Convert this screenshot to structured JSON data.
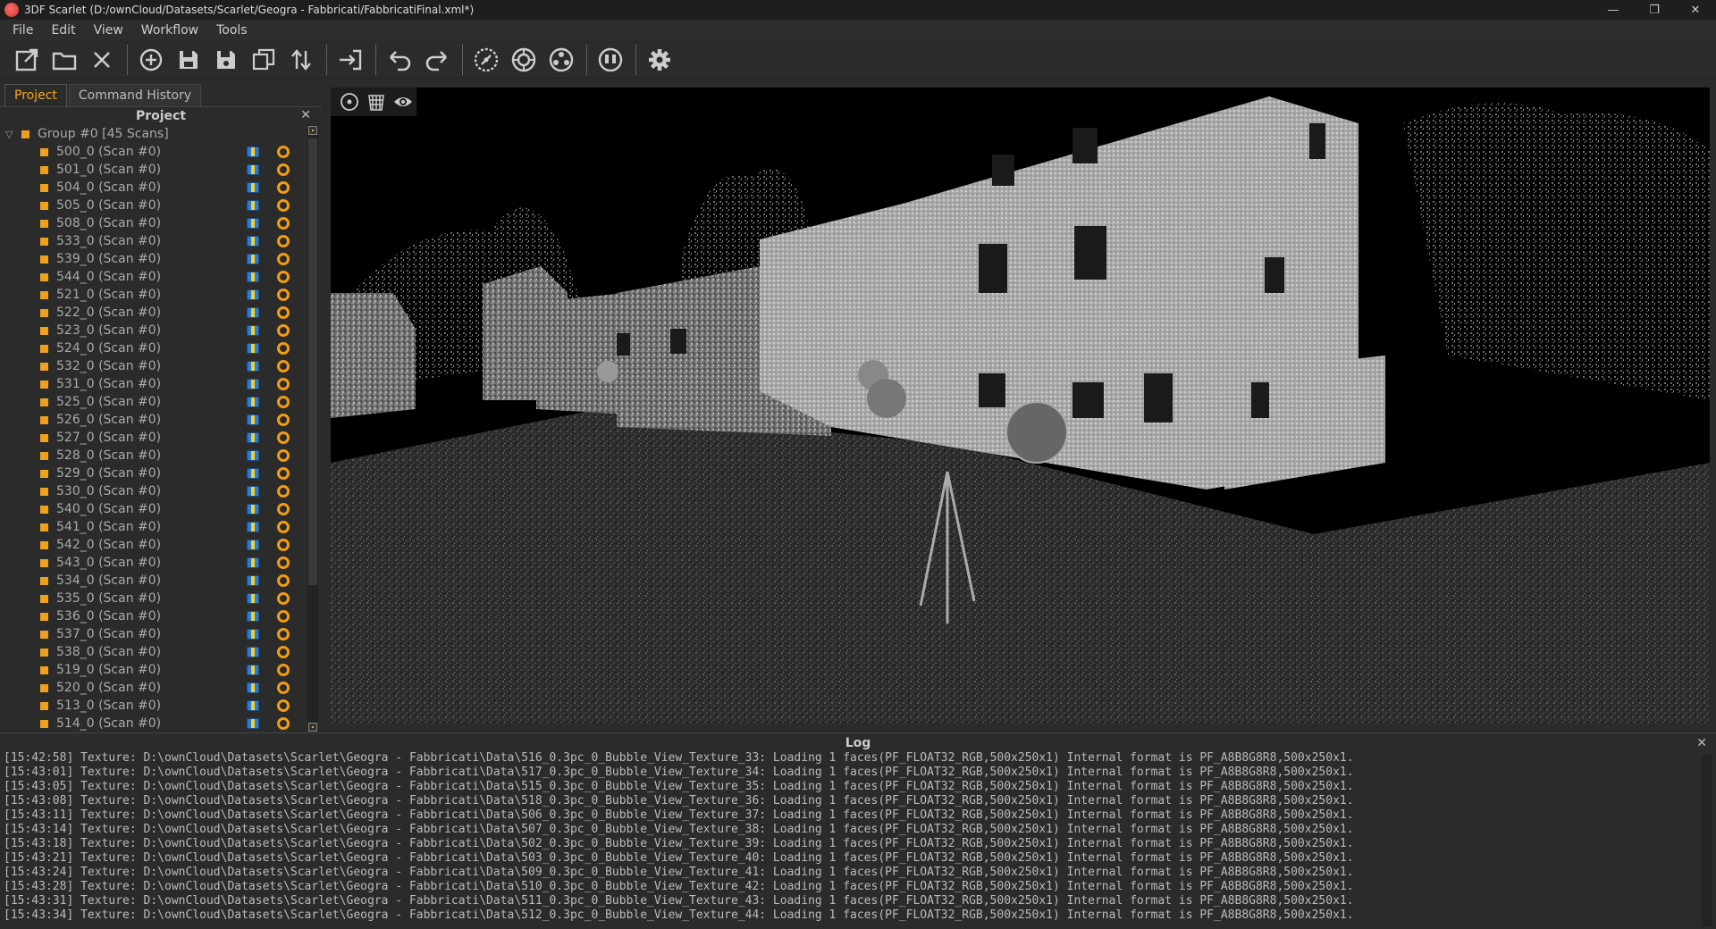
{
  "window": {
    "title": "3DF Scarlet (D:/ownCloud/Datasets/Scarlet/Geogra - Fabbricati/FabbricatiFinal.xml*)",
    "minimize": "—",
    "maximize": "❐",
    "close": "✕"
  },
  "menu": [
    "File",
    "Edit",
    "View",
    "Workflow",
    "Tools"
  ],
  "toolbar": {
    "icons": [
      "open-external-icon",
      "open-folder-icon",
      "close-project-icon",
      "add-icon",
      "save-icon",
      "save-as-icon",
      "duplicate-icon",
      "import-export-icon",
      "export-icon",
      "undo-icon",
      "redo-icon",
      "scan-registration-icon",
      "target-detect-icon",
      "cloud-merge-icon",
      "workflow-icon",
      "settings-icon"
    ]
  },
  "left_panel": {
    "tabs": [
      {
        "label": "Project",
        "active": true
      },
      {
        "label": "Command History",
        "active": false
      }
    ],
    "header": "Project",
    "close": "✕",
    "group": {
      "label": "Group #0 [45 Scans]"
    },
    "scans": [
      "500_0 (Scan #0)",
      "501_0 (Scan #0)",
      "504_0 (Scan #0)",
      "505_0 (Scan #0)",
      "508_0 (Scan #0)",
      "533_0 (Scan #0)",
      "539_0 (Scan #0)",
      "544_0 (Scan #0)",
      "521_0 (Scan #0)",
      "522_0 (Scan #0)",
      "523_0 (Scan #0)",
      "524_0 (Scan #0)",
      "532_0 (Scan #0)",
      "531_0 (Scan #0)",
      "525_0 (Scan #0)",
      "526_0 (Scan #0)",
      "527_0 (Scan #0)",
      "528_0 (Scan #0)",
      "529_0 (Scan #0)",
      "530_0 (Scan #0)",
      "540_0 (Scan #0)",
      "541_0 (Scan #0)",
      "542_0 (Scan #0)",
      "543_0 (Scan #0)",
      "534_0 (Scan #0)",
      "535_0 (Scan #0)",
      "536_0 (Scan #0)",
      "537_0 (Scan #0)",
      "538_0 (Scan #0)",
      "519_0 (Scan #0)",
      "520_0 (Scan #0)",
      "513_0 (Scan #0)",
      "514_0 (Scan #0)"
    ]
  },
  "viewport": {
    "tools": [
      "orbit-icon",
      "clip-box-icon",
      "visibility-icon"
    ]
  },
  "log": {
    "title": "Log",
    "close": "✕",
    "lines": [
      "[15:42:58] Texture: D:\\ownCloud\\Datasets\\Scarlet\\Geogra - Fabbricati\\Data\\516_0.3pc_0_Bubble_View_Texture_33: Loading 1 faces(PF_FLOAT32_RGB,500x250x1) Internal format is PF_A8B8G8R8,500x250x1.",
      "[15:43:01] Texture: D:\\ownCloud\\Datasets\\Scarlet\\Geogra - Fabbricati\\Data\\517_0.3pc_0_Bubble_View_Texture_34: Loading 1 faces(PF_FLOAT32_RGB,500x250x1) Internal format is PF_A8B8G8R8,500x250x1.",
      "[15:43:05] Texture: D:\\ownCloud\\Datasets\\Scarlet\\Geogra - Fabbricati\\Data\\515_0.3pc_0_Bubble_View_Texture_35: Loading 1 faces(PF_FLOAT32_RGB,500x250x1) Internal format is PF_A8B8G8R8,500x250x1.",
      "[15:43:08] Texture: D:\\ownCloud\\Datasets\\Scarlet\\Geogra - Fabbricati\\Data\\518_0.3pc_0_Bubble_View_Texture_36: Loading 1 faces(PF_FLOAT32_RGB,500x250x1) Internal format is PF_A8B8G8R8,500x250x1.",
      "[15:43:11] Texture: D:\\ownCloud\\Datasets\\Scarlet\\Geogra - Fabbricati\\Data\\506_0.3pc_0_Bubble_View_Texture_37: Loading 1 faces(PF_FLOAT32_RGB,500x250x1) Internal format is PF_A8B8G8R8,500x250x1.",
      "[15:43:14] Texture: D:\\ownCloud\\Datasets\\Scarlet\\Geogra - Fabbricati\\Data\\507_0.3pc_0_Bubble_View_Texture_38: Loading 1 faces(PF_FLOAT32_RGB,500x250x1) Internal format is PF_A8B8G8R8,500x250x1.",
      "[15:43:18] Texture: D:\\ownCloud\\Datasets\\Scarlet\\Geogra - Fabbricati\\Data\\502_0.3pc_0_Bubble_View_Texture_39: Loading 1 faces(PF_FLOAT32_RGB,500x250x1) Internal format is PF_A8B8G8R8,500x250x1.",
      "[15:43:21] Texture: D:\\ownCloud\\Datasets\\Scarlet\\Geogra - Fabbricati\\Data\\503_0.3pc_0_Bubble_View_Texture_40: Loading 1 faces(PF_FLOAT32_RGB,500x250x1) Internal format is PF_A8B8G8R8,500x250x1.",
      "[15:43:24] Texture: D:\\ownCloud\\Datasets\\Scarlet\\Geogra - Fabbricati\\Data\\509_0.3pc_0_Bubble_View_Texture_41: Loading 1 faces(PF_FLOAT32_RGB,500x250x1) Internal format is PF_A8B8G8R8,500x250x1.",
      "[15:43:28] Texture: D:\\ownCloud\\Datasets\\Scarlet\\Geogra - Fabbricati\\Data\\510_0.3pc_0_Bubble_View_Texture_42: Loading 1 faces(PF_FLOAT32_RGB,500x250x1) Internal format is PF_A8B8G8R8,500x250x1.",
      "[15:43:31] Texture: D:\\ownCloud\\Datasets\\Scarlet\\Geogra - Fabbricati\\Data\\511_0.3pc_0_Bubble_View_Texture_43: Loading 1 faces(PF_FLOAT32_RGB,500x250x1) Internal format is PF_A8B8G8R8,500x250x1.",
      "[15:43:34] Texture: D:\\ownCloud\\Datasets\\Scarlet\\Geogra - Fabbricati\\Data\\512_0.3pc_0_Bubble_View_Texture_44: Loading 1 faces(PF_FLOAT32_RGB,500x250x1) Internal format is PF_A8B8G8R8,500x250x1."
    ]
  },
  "colors": {
    "accent": "#f0a020",
    "background": "#2b2b2b",
    "viewport": "#000000"
  }
}
